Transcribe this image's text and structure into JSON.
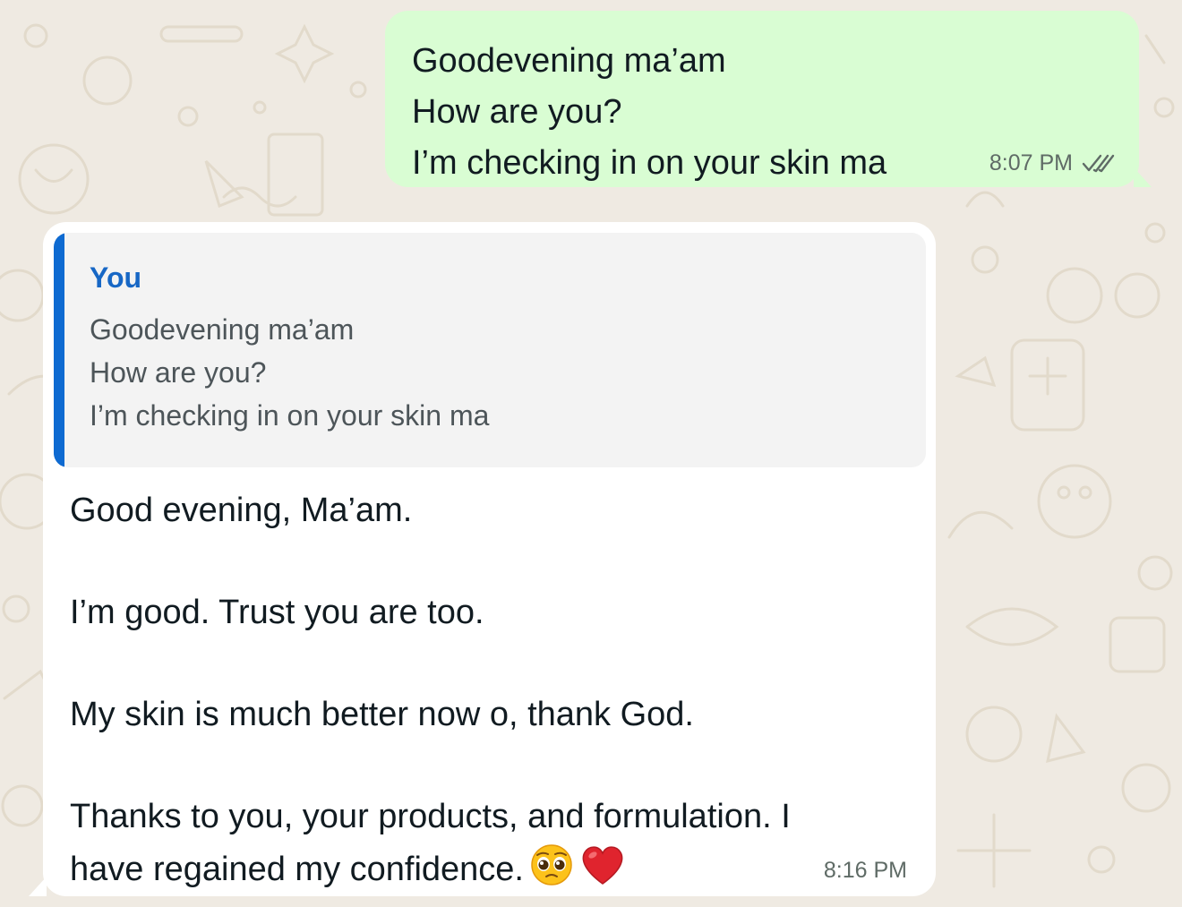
{
  "outgoing": {
    "lines": [
      "Goodevening ma’am",
      "How are you?",
      "I’m checking in on your skin ma"
    ],
    "time": "8:07 PM",
    "status_icon": "double-check-icon"
  },
  "incoming": {
    "quote": {
      "author": "You",
      "lines": [
        "Goodevening ma’am",
        "How are you?",
        "I’m checking in on your skin ma"
      ]
    },
    "paragraphs": [
      "Good evening, Ma’am.",
      "I’m good. Trust you are too.",
      "My skin is much better now o, thank God.",
      "Thanks to you, your products, and formulation. I",
      "have regained my confidence."
    ],
    "emojis": [
      "pleading-face-icon",
      "red-heart-icon"
    ],
    "time": "8:16 PM"
  },
  "colors": {
    "background": "#efeae2",
    "outgoing_bubble": "#d9fdd3",
    "incoming_bubble": "#ffffff",
    "quote_accent": "#0e6ad1",
    "quote_author": "#1767c5"
  }
}
